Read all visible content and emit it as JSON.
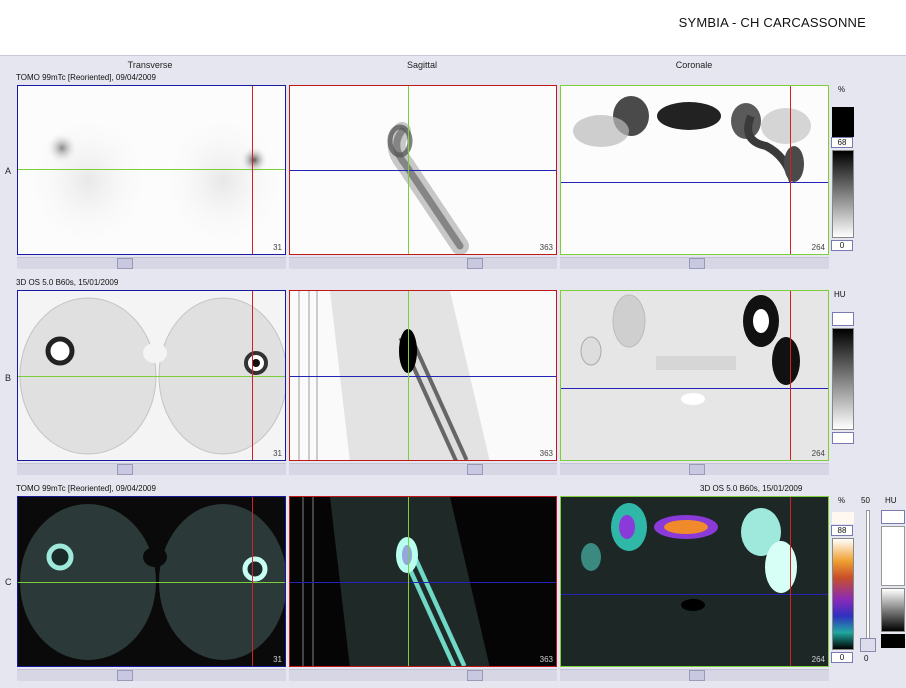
{
  "header": {
    "site_title": "SYMBIA - CH CARCASSONNE"
  },
  "columns": {
    "transverse": "Transverse",
    "sagittal": "Sagittal",
    "coronal": "Coronale"
  },
  "rows": {
    "a": {
      "letter": "A",
      "caption": "TOMO 99mTc [Reoriented], 09/04/2009"
    },
    "b": {
      "letter": "B",
      "caption": "3D  OS  5.0  B60s, 15/01/2009"
    },
    "c": {
      "letter": "C",
      "caption_left": "TOMO 99mTc [Reoriented], 09/04/2009",
      "caption_right": "3D  OS  5.0  B60s, 15/01/2009"
    }
  },
  "slices": {
    "transverse": "31",
    "sagittal": "363",
    "coronal": "264"
  },
  "colorbars": {
    "a": {
      "unit": "%",
      "max": "68",
      "min": "0"
    },
    "b": {
      "unit": "HU"
    },
    "c": {
      "unit_pct": "%",
      "max": "88",
      "min": "0",
      "unit_hu": "HU",
      "blend": "50",
      "blend_min": "0"
    }
  },
  "colors": {
    "crosshair_green": "#7ccf3a",
    "crosshair_blue": "#2323b8",
    "crosshair_red": "#d42020",
    "frame_transverse": "#1a1aa0",
    "frame_sagittal": "#c01818",
    "frame_coronal": "#7ccf3a"
  }
}
